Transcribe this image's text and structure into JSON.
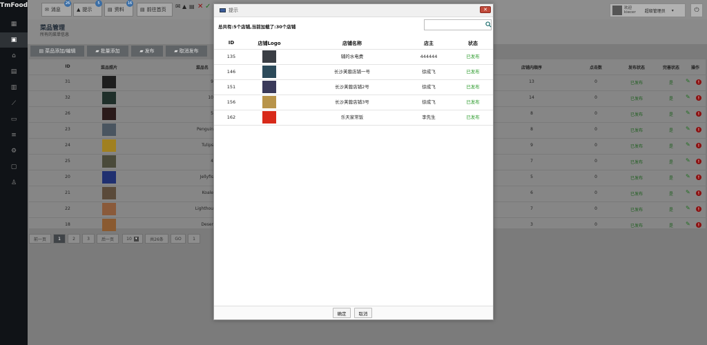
{
  "app": {
    "logo": "TmFood"
  },
  "topbar": {
    "messages": {
      "label": "消息",
      "badge": "26"
    },
    "alerts": {
      "label": "提示",
      "badge": "5"
    },
    "info": {
      "label": "资料",
      "badge": "16"
    },
    "homepage": {
      "label": "前往首页"
    },
    "user": {
      "greeting": "欢迎",
      "name": "kiecer",
      "role": "超级管理员"
    }
  },
  "page": {
    "title": "菜品管理",
    "subtitle": "所有的菜单信息"
  },
  "toolbar": {
    "add_edit": "菜品添加/编辑",
    "batch_add": "批量添加",
    "publish": "发布",
    "unpublish": "取消发布"
  },
  "bg_table": {
    "headers": {
      "id": "ID",
      "photo": "菜品照片",
      "name": "菜品名",
      "order": "店铺内顺序",
      "clicks": "点击数",
      "publish_status": "发布状态",
      "recommend_status": "完善状态",
      "ops": "操作"
    },
    "rows": [
      {
        "id": "31",
        "name": "9",
        "order": "13",
        "clicks": "0",
        "status": "已发布",
        "rec": "是"
      },
      {
        "id": "32",
        "name": "10",
        "order": "14",
        "clicks": "0",
        "status": "已发布",
        "rec": "是"
      },
      {
        "id": "26",
        "name": "5",
        "order": "8",
        "clicks": "0",
        "status": "已发布",
        "rec": "是"
      },
      {
        "id": "23",
        "name": "Penguin",
        "order": "8",
        "clicks": "0",
        "status": "已发布",
        "rec": "是"
      },
      {
        "id": "24",
        "name": "Tulips",
        "order": "9",
        "clicks": "0",
        "status": "已发布",
        "rec": "是"
      },
      {
        "id": "25",
        "name": "4",
        "order": "7",
        "clicks": "0",
        "status": "已发布",
        "rec": "是"
      },
      {
        "id": "20",
        "name": "Jellyfis",
        "order": "5",
        "clicks": "0",
        "status": "已发布",
        "rec": "是"
      },
      {
        "id": "21",
        "name": "Koale",
        "order": "6",
        "clicks": "0",
        "status": "已发布",
        "rec": "是"
      },
      {
        "id": "22",
        "name": "Lighthou",
        "order": "7",
        "clicks": "0",
        "status": "已发布",
        "rec": "是"
      },
      {
        "id": "18",
        "name": "Deser",
        "order": "3",
        "clicks": "0",
        "status": "已发布",
        "rec": "是"
      }
    ]
  },
  "pagination": {
    "prev": "前一页",
    "p1": "1",
    "p2": "2",
    "p3": "3",
    "next": "后一页",
    "page_size": "10",
    "total": "共26条",
    "go": "GO",
    "jump": "1"
  },
  "modal": {
    "title": "提示",
    "summary": "总共有:5个店铺,当前加载了:30个店铺",
    "search": {
      "placeholder": ""
    },
    "headers": {
      "id": "ID",
      "logo": "店铺Logo",
      "name": "店铺名称",
      "owner": "店主",
      "status": "状态"
    },
    "rows": [
      {
        "id": "135",
        "name": "辅的水电费",
        "owner": "444444",
        "status": "已发布"
      },
      {
        "id": "146",
        "name": "长沙芙蓉店铺一号",
        "owner": "徐成飞",
        "status": "已发布"
      },
      {
        "id": "151",
        "name": "长沙芙蓉店铺2号",
        "owner": "徐成飞",
        "status": "已发布"
      },
      {
        "id": "156",
        "name": "长沙芙蓉店铺3号",
        "owner": "徐成飞",
        "status": "已发布"
      },
      {
        "id": "162",
        "name": "乐天家常饭",
        "owner": "李先生",
        "status": "已发布"
      }
    ],
    "confirm": "确定",
    "cancel": "取消"
  },
  "colors": {
    "status_green": "#2a9a2a",
    "overlay": "#7b7b7b"
  }
}
